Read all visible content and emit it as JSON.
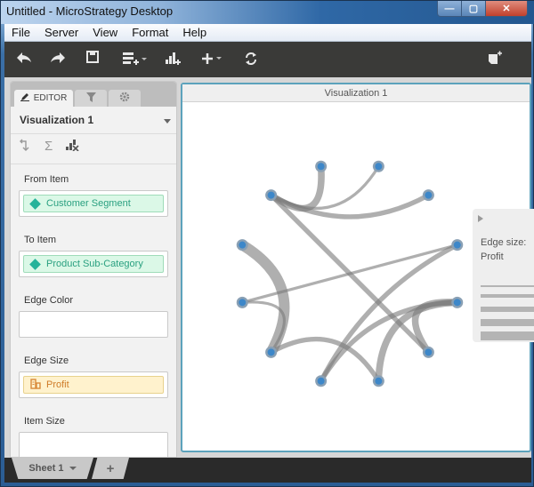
{
  "window": {
    "title": "Untitled - MicroStrategy Desktop",
    "controls": {
      "minimize": "—",
      "maximize": "▢",
      "close": "✕"
    }
  },
  "menu": {
    "items": [
      "File",
      "Server",
      "View",
      "Format",
      "Help"
    ]
  },
  "toolbar": {
    "icons": [
      "undo-icon",
      "redo-icon",
      "save-icon",
      "add-data-icon",
      "add-visualization-icon",
      "insert-icon",
      "refresh-icon",
      "new-page-icon"
    ]
  },
  "editor_panel": {
    "tabs": [
      {
        "label": "EDITOR",
        "icon": "pencil-icon"
      },
      {
        "label": "",
        "icon": "filter-icon"
      },
      {
        "label": "",
        "icon": "gear-icon"
      }
    ],
    "visualization_selector": "Visualization 1",
    "tool_icons": [
      "swap-axes-icon",
      "sigma-icon",
      "chart-clear-icon"
    ],
    "fields": [
      {
        "label": "From Item",
        "value": "Customer Segment",
        "type": "attribute"
      },
      {
        "label": "To Item",
        "value": "Product Sub-Category",
        "type": "attribute"
      },
      {
        "label": "Edge Color",
        "value": "",
        "type": "empty"
      },
      {
        "label": "Edge Size",
        "value": "Profit",
        "type": "metric"
      },
      {
        "label": "Item Size",
        "value": "",
        "type": "empty"
      }
    ]
  },
  "visualization": {
    "title": "Visualization 1",
    "type": "network",
    "node_color": "#3d87c9",
    "edge_color": "#7a7a7a",
    "legend": {
      "title_line1": "Edge size:",
      "title_line2": "Profit",
      "levels": 5
    }
  },
  "sheets": {
    "tabs": [
      {
        "label": "Sheet 1"
      }
    ],
    "add_label": "+"
  },
  "chart_data": {
    "type": "network",
    "title": "Visualization 1",
    "nodes": [
      "n1",
      "n2",
      "n3",
      "n4",
      "n5",
      "n6",
      "n7",
      "n8",
      "n9",
      "n10",
      "n11",
      "n12"
    ],
    "edges": [
      {
        "from": "n3",
        "to": "n1",
        "weight": 3
      },
      {
        "from": "n3",
        "to": "n2",
        "weight": 1
      },
      {
        "from": "n3",
        "to": "n4",
        "weight": 2
      },
      {
        "from": "n3",
        "to": "n10",
        "weight": 2
      },
      {
        "from": "n5",
        "to": "n9",
        "weight": 5
      },
      {
        "from": "n7",
        "to": "n6",
        "weight": 1
      },
      {
        "from": "n7",
        "to": "n9",
        "weight": 1
      },
      {
        "from": "n9",
        "to": "n12",
        "weight": 2
      },
      {
        "from": "n11",
        "to": "n6",
        "weight": 2
      },
      {
        "from": "n11",
        "to": "n8",
        "weight": 2
      },
      {
        "from": "n12",
        "to": "n8",
        "weight": 3
      },
      {
        "from": "n10",
        "to": "n8",
        "weight": 3
      }
    ],
    "legend": {
      "title": "Edge size: Profit",
      "placement": "right"
    }
  }
}
